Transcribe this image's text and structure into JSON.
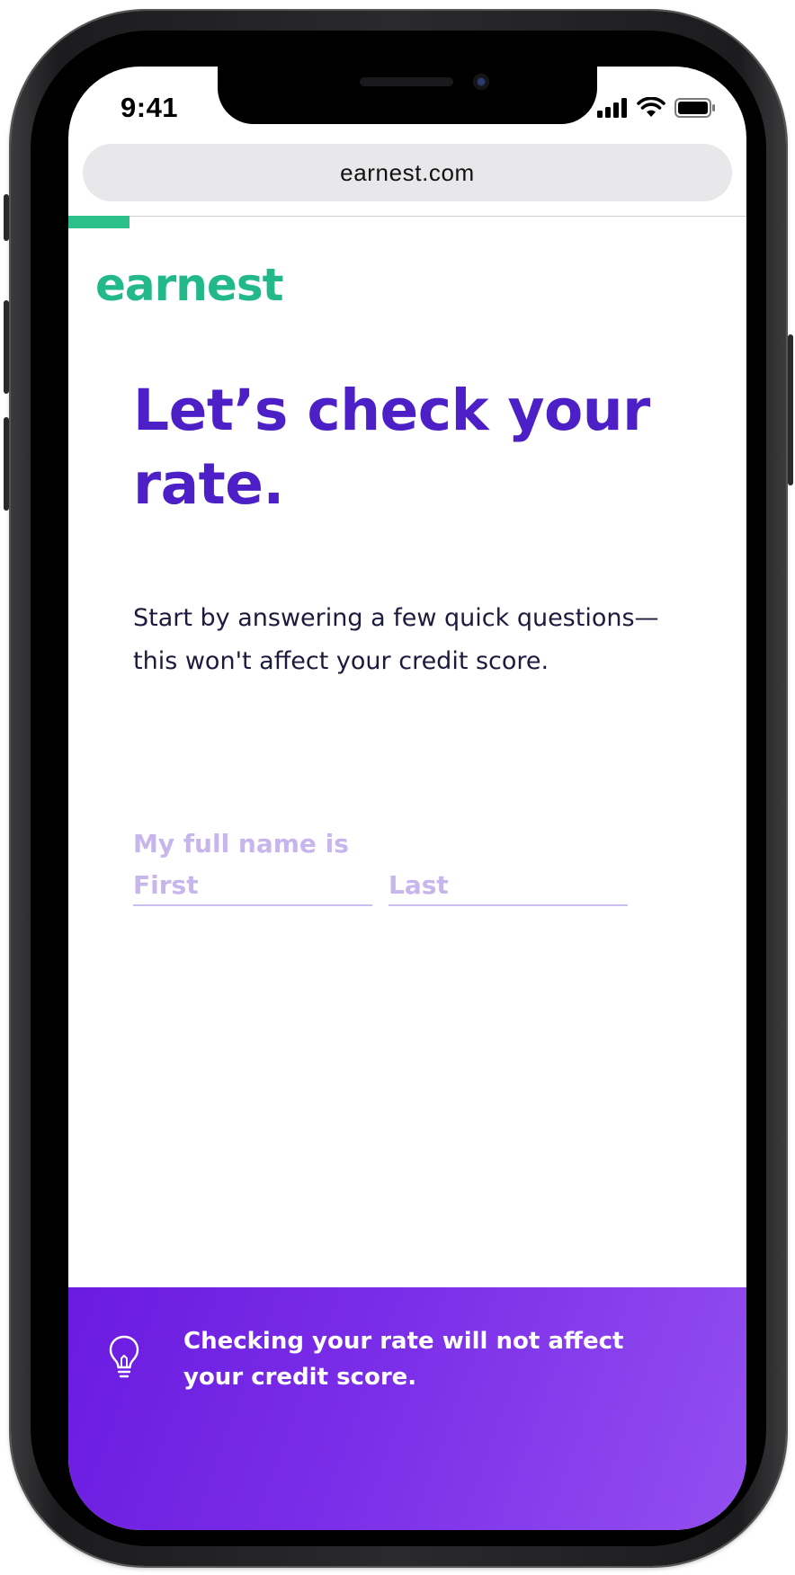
{
  "status_bar": {
    "time": "9:41"
  },
  "browser": {
    "url": "earnest.com"
  },
  "progress": {
    "percent": 9
  },
  "brand": {
    "logo_text": "earnest",
    "accent_color": "#22b88a",
    "primary_color": "#4d1fc7"
  },
  "main": {
    "headline": "Let’s check your rate.",
    "subhead": "Start by answering a few quick questions—this won't affect your credit score."
  },
  "form": {
    "name_label": "My full name is",
    "first_placeholder": "First",
    "first_value": "",
    "last_placeholder": "Last",
    "last_value": ""
  },
  "banner": {
    "icon": "lightbulb-icon",
    "text": "Checking your rate will not affect your credit score."
  }
}
